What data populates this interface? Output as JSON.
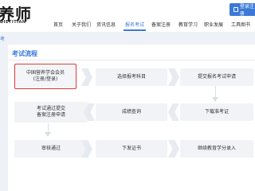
{
  "header": {
    "logo_title": "养师",
    "logo_subtitle": "DIETITIAN",
    "login_label": "登录注册"
  },
  "nav": {
    "items": [
      "首页",
      "关于我们",
      "资讯信息",
      "报名考试",
      "备案注册",
      "教育学习",
      "职业发展",
      "工具图书"
    ],
    "active": "报名考试"
  },
  "breadcrumb": "考",
  "section": {
    "title": "考试流程"
  },
  "steps": {
    "s1": "中国营养学会会员(注册/登录)",
    "s1_line1": "中国营养学会会员",
    "s1_line2": "(注册/登录)",
    "s2": "选择报考科目",
    "s3": "提交报名考试申请",
    "s4_line1": "考试通过提交",
    "s4_line2": "备案注册申请",
    "s5": "成绩查询",
    "s6": "下载准考证",
    "s7": "审核通过",
    "s8": "下发证书",
    "s9": "继续教育学分录入"
  },
  "colors": {
    "accent": "#3a79d8",
    "highlight_border": "#e23a3a",
    "step_bg": "#f1f3f7",
    "page_bg": "#eef1f6"
  }
}
